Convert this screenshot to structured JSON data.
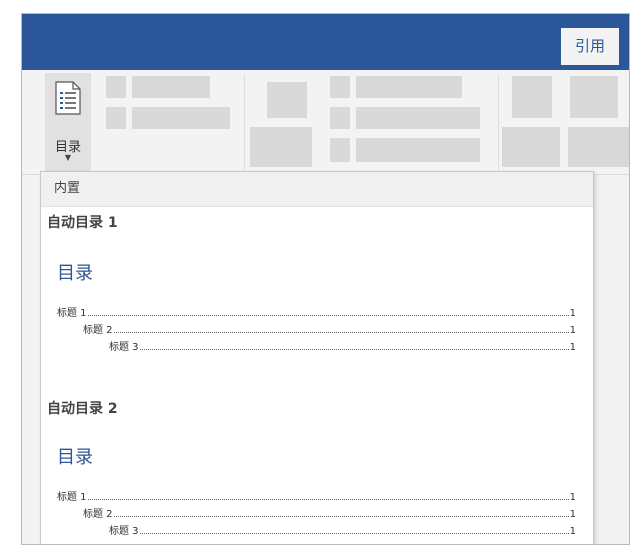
{
  "ribbon": {
    "active_tab": "引用",
    "toc_button_label": "目录"
  },
  "dropdown": {
    "section_label": "内置",
    "items": [
      {
        "title": "自动目录 1",
        "preview_heading": "目录",
        "entries": [
          {
            "text": "标题 1",
            "page": "1"
          },
          {
            "text": "标题 2",
            "page": "1"
          },
          {
            "text": "标题 3",
            "page": "1"
          }
        ]
      },
      {
        "title": "自动目录 2",
        "preview_heading": "目录",
        "entries": [
          {
            "text": "标题 1",
            "page": "1"
          },
          {
            "text": "标题 2",
            "page": "1"
          },
          {
            "text": "标题 3",
            "page": "1"
          }
        ]
      }
    ]
  },
  "colors": {
    "title_bar": "#2b579a",
    "toc_heading": "#2e5597",
    "ribbon_bg": "#f3f3f3"
  },
  "icons": {
    "toc_button_icon": "document-lines-icon",
    "dropdown_arrow": "caret-down-icon"
  }
}
